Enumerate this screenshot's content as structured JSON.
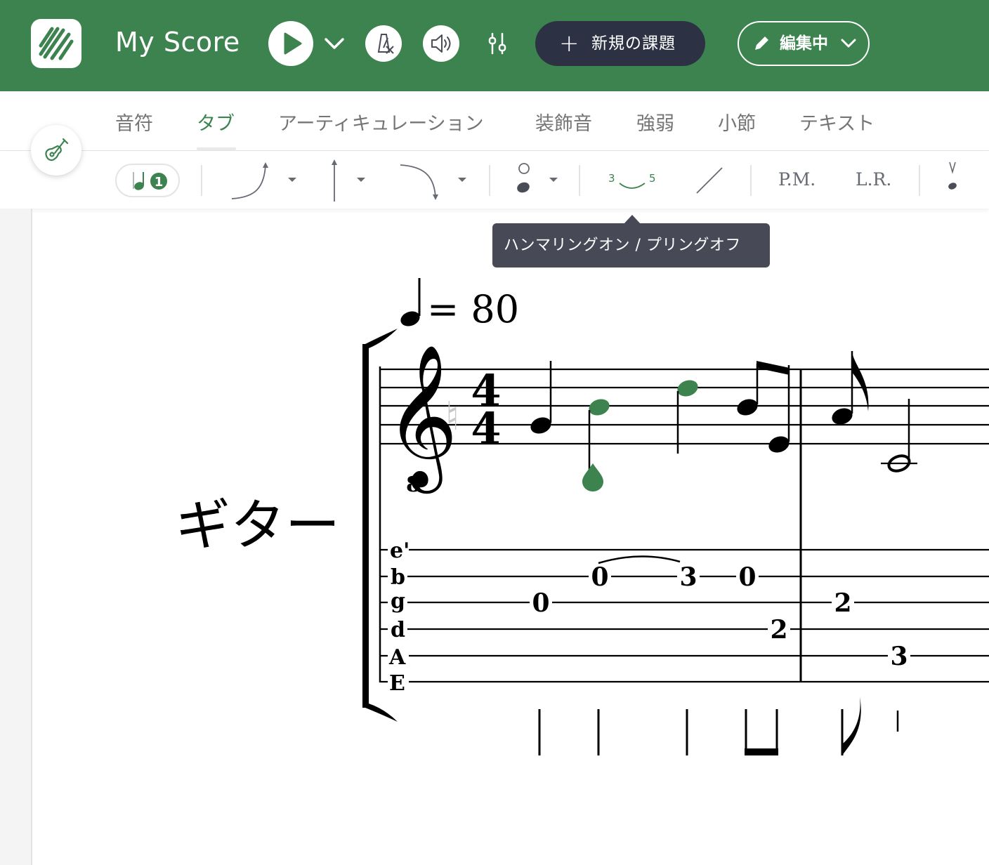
{
  "header": {
    "title": "My Score",
    "new_task_label": "新規の課題",
    "edit_mode_label": "編集中",
    "colors": {
      "brand_green": "#3d834f",
      "dark_button": "#2c3244"
    },
    "icons": [
      "logo-icon",
      "play-icon",
      "chevron-down-icon",
      "metronome-off-icon",
      "speaker-icon",
      "mixer-icon",
      "plus-icon",
      "pencil-icon"
    ]
  },
  "tabs": [
    {
      "label": "音符",
      "active": false
    },
    {
      "label": "タブ",
      "active": true
    },
    {
      "label": "アーティキュレーション",
      "active": false
    },
    {
      "label": "装飾音",
      "active": false
    },
    {
      "label": "強弱",
      "active": false
    },
    {
      "label": "小節",
      "active": false
    },
    {
      "label": "テキスト",
      "active": false
    }
  ],
  "toolbar": {
    "voice_number": "1",
    "hammer_on_from": "3",
    "hammer_on_to": "5",
    "palm_mute": "P.M.",
    "let_ring": "L.R.",
    "tooltip": "ハンマリングオン / プリングオフ"
  },
  "score": {
    "tempo_equals": "= 80",
    "instrument_name": "ギター",
    "time_signature": [
      "4",
      "4"
    ],
    "clef_octave": "8",
    "tab_strings": [
      "e'",
      "b",
      "g",
      "d",
      "A",
      "E"
    ],
    "measure1_frets": [
      "0",
      "0",
      "3",
      "0",
      "2"
    ],
    "measure2_frets": [
      "2",
      "3"
    ],
    "selection_color": "#3d834f"
  }
}
